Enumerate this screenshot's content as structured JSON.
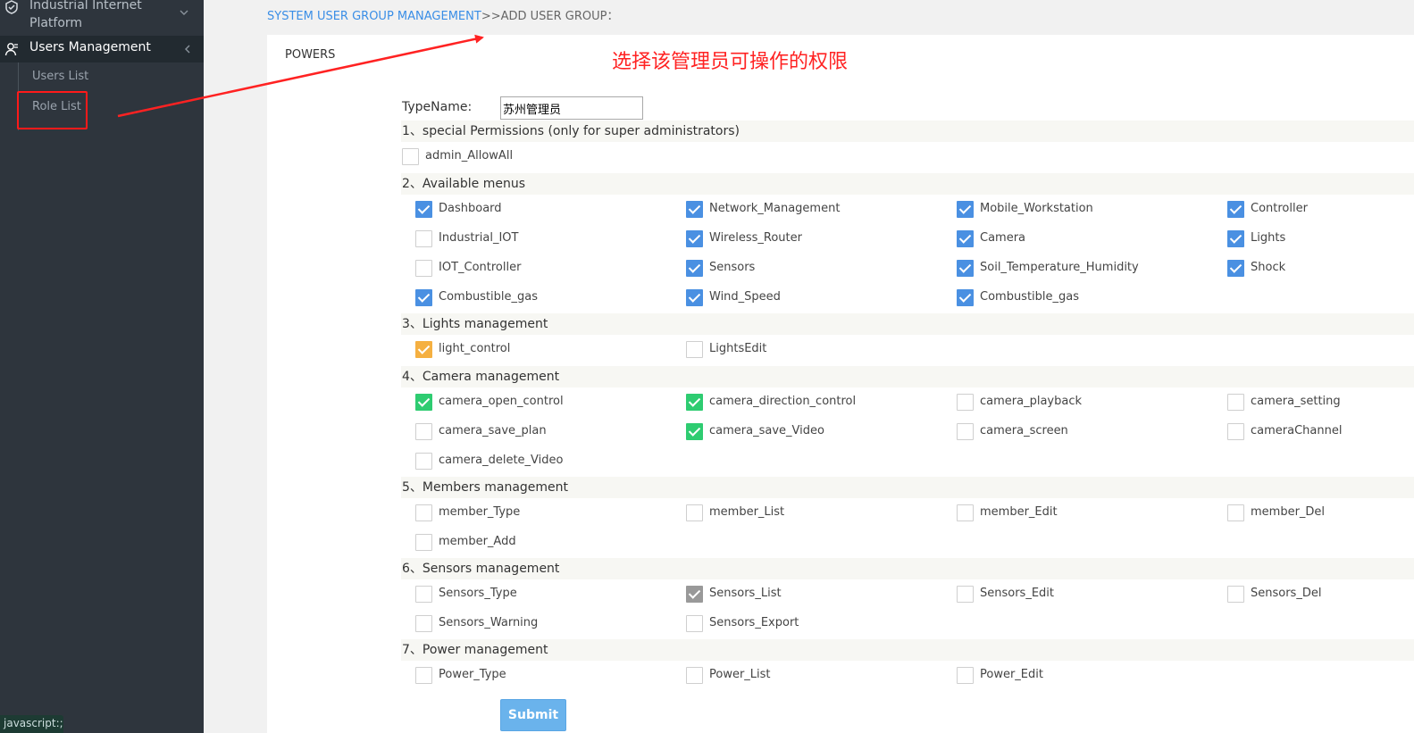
{
  "sidebar": {
    "platform": "Industrial Internet Platform",
    "users_management": "Users Management",
    "users_list": "Users List",
    "role_list": "Role List",
    "status": "javascript:;"
  },
  "breadcrumb": {
    "link": "SYSTEM USER GROUP MANAGEMENT",
    "rest": ">>ADD USER GROUP："
  },
  "panel": {
    "powers": "POWERS",
    "annotation": "选择该管理员可操作的权限",
    "typename_label": "TypeName:",
    "typename_value": "苏州管理员",
    "submit": "Submit"
  },
  "colors": {
    "blue": "#4a90e2",
    "orange": "#f5b041",
    "green": "#2ecc71",
    "gray": "#999999",
    "annotation_red": "#ff2222"
  },
  "sections": [
    {
      "title": "1、special Permissions (only for super administrators)",
      "items": [
        {
          "label": "admin_AllowAll",
          "checked": false
        }
      ]
    },
    {
      "title": "2、Available menus",
      "items": [
        {
          "label": "Dashboard",
          "checked": true,
          "color": "blue"
        },
        {
          "label": "Network_Management",
          "checked": true,
          "color": "blue"
        },
        {
          "label": "Mobile_Workstation",
          "checked": true,
          "color": "blue"
        },
        {
          "label": "Controller",
          "checked": true,
          "color": "blue"
        },
        {
          "label": "Industrial_IOT",
          "checked": false
        },
        {
          "label": "Wireless_Router",
          "checked": true,
          "color": "blue"
        },
        {
          "label": "Camera",
          "checked": true,
          "color": "blue"
        },
        {
          "label": "Lights",
          "checked": true,
          "color": "blue"
        },
        {
          "label": "IOT_Controller",
          "checked": false
        },
        {
          "label": "Sensors",
          "checked": true,
          "color": "blue"
        },
        {
          "label": "Soil_Temperature_Humidity",
          "checked": true,
          "color": "blue"
        },
        {
          "label": "Shock",
          "checked": true,
          "color": "blue"
        },
        {
          "label": "Combustible_gas",
          "checked": true,
          "color": "blue"
        },
        {
          "label": "Wind_Speed",
          "checked": true,
          "color": "blue"
        },
        {
          "label": "Combustible_gas",
          "checked": true,
          "color": "blue"
        }
      ]
    },
    {
      "title": "3、Lights management",
      "items": [
        {
          "label": "light_control",
          "checked": true,
          "color": "orange"
        },
        {
          "label": "LightsEdit",
          "checked": false
        }
      ]
    },
    {
      "title": "4、Camera management",
      "items": [
        {
          "label": "camera_open_control",
          "checked": true,
          "color": "green"
        },
        {
          "label": "camera_direction_control",
          "checked": true,
          "color": "green"
        },
        {
          "label": "camera_playback",
          "checked": false
        },
        {
          "label": "camera_setting",
          "checked": false
        },
        {
          "label": "camera_save_plan",
          "checked": false
        },
        {
          "label": "camera_save_Video",
          "checked": true,
          "color": "green"
        },
        {
          "label": "camera_screen",
          "checked": false
        },
        {
          "label": "cameraChannel",
          "checked": false
        },
        {
          "label": "camera_delete_Video",
          "checked": false
        }
      ]
    },
    {
      "title": "5、Members management",
      "items": [
        {
          "label": "member_Type",
          "checked": false
        },
        {
          "label": "member_List",
          "checked": false
        },
        {
          "label": "member_Edit",
          "checked": false
        },
        {
          "label": "member_Del",
          "checked": false
        },
        {
          "label": "member_Add",
          "checked": false
        }
      ]
    },
    {
      "title": "6、Sensors management",
      "items": [
        {
          "label": "Sensors_Type",
          "checked": false
        },
        {
          "label": "Sensors_List",
          "checked": true,
          "color": "gray"
        },
        {
          "label": "Sensors_Edit",
          "checked": false
        },
        {
          "label": "Sensors_Del",
          "checked": false
        },
        {
          "label": "Sensors_Warning",
          "checked": false
        },
        {
          "label": "Sensors_Export",
          "checked": false
        }
      ]
    },
    {
      "title": "7、Power management",
      "items": [
        {
          "label": "Power_Type",
          "checked": false
        },
        {
          "label": "Power_List",
          "checked": false
        },
        {
          "label": "Power_Edit",
          "checked": false
        }
      ]
    }
  ]
}
